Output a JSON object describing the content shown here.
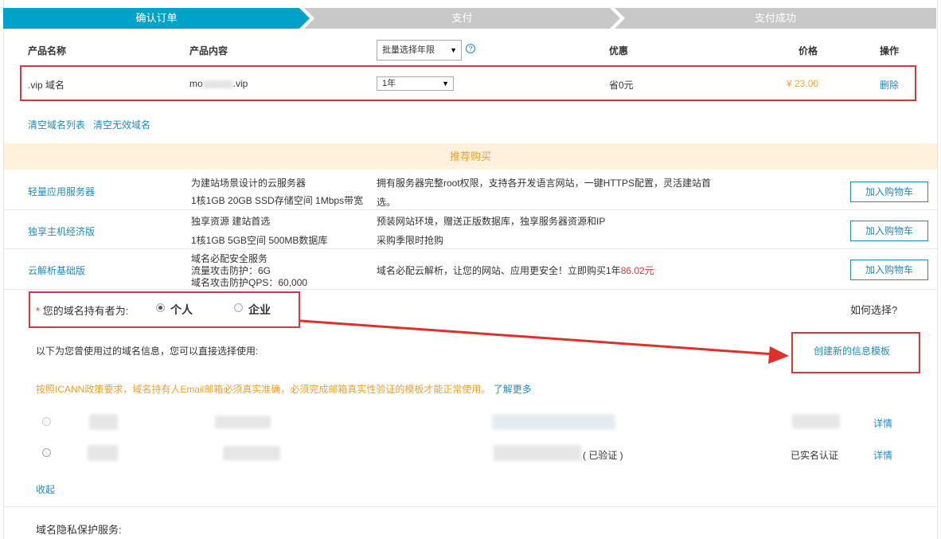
{
  "steps": [
    "确认订单",
    "支付",
    "支付成功"
  ],
  "table": {
    "headers": {
      "name": "产品名称",
      "content": "产品内容",
      "discount": "优惠",
      "price": "价格",
      "action": "操作"
    },
    "bulk_select": "批量选择年限",
    "row": {
      "name": ".vip 域名",
      "content_prefix": "mo",
      "content_suffix": ".vip",
      "year": "1年",
      "discount": "省0元",
      "price": "¥ 23.00",
      "delete": "删除"
    }
  },
  "links": {
    "clear_list": "清空域名列表",
    "clear_invalid": "清空无效域名"
  },
  "recommend": {
    "title": "推荐购买",
    "items": [
      {
        "name": "轻量应用服务器",
        "spec1": "为建站场景设计的云服务器",
        "spec2": "1核1GB 20GB SSD存储空间 1Mbps带宽",
        "desc1": "拥有服务器完整root权限，支持各开发语言网站，一键HTTPS配置，灵活建站首",
        "desc2": "选。",
        "button": "加入购物车"
      },
      {
        "name": "独享主机经济版",
        "spec1": "独享资源 建站首选",
        "spec2": "1核1GB 5GB空间 500MB数据库",
        "desc1": "预装网站环境，赠送正版数据库，独享服务器资源和IP",
        "desc2": "采购季限时抢购",
        "button": "加入购物车"
      },
      {
        "name": "云解析基础版",
        "spec1": "域名必配安全服务",
        "spec2": "流量攻击防护：6G",
        "spec3": "域名攻击防护QPS：60,000",
        "desc1": "域名必配云解析，让您的网站、应用更安全！立即购买1年",
        "desc_price": "86.02元",
        "button": "加入购物车"
      }
    ]
  },
  "owner": {
    "required": "*",
    "label": "您的域名持有者为:",
    "option_personal": "个人",
    "option_company": "企业",
    "how": "如何选择?"
  },
  "info": {
    "used_text": "以下为您曾使用过的域名信息，您可以直接选择使用:",
    "create_template": "创建新的信息模板",
    "icann_notice": "按照ICANN政策要求，域名持有人Email邮箱必须真实准确，必须完成邮箱真实性验证的模板才能正常使用。",
    "learn_more": "了解更多",
    "rows": [
      {
        "status": "",
        "detail": "详情"
      },
      {
        "verified": "( 已验证 )",
        "status": "已实名认证",
        "detail": "详情"
      }
    ],
    "collapse": "收起"
  },
  "privacy": {
    "label": "域名隐私保护服务:"
  },
  "colors": {
    "accent": "#00a2ca",
    "link": "#1f8ac2",
    "highlight": "#d9363e",
    "price": "#f3a43a",
    "reco_bg": "#fff1dc"
  }
}
